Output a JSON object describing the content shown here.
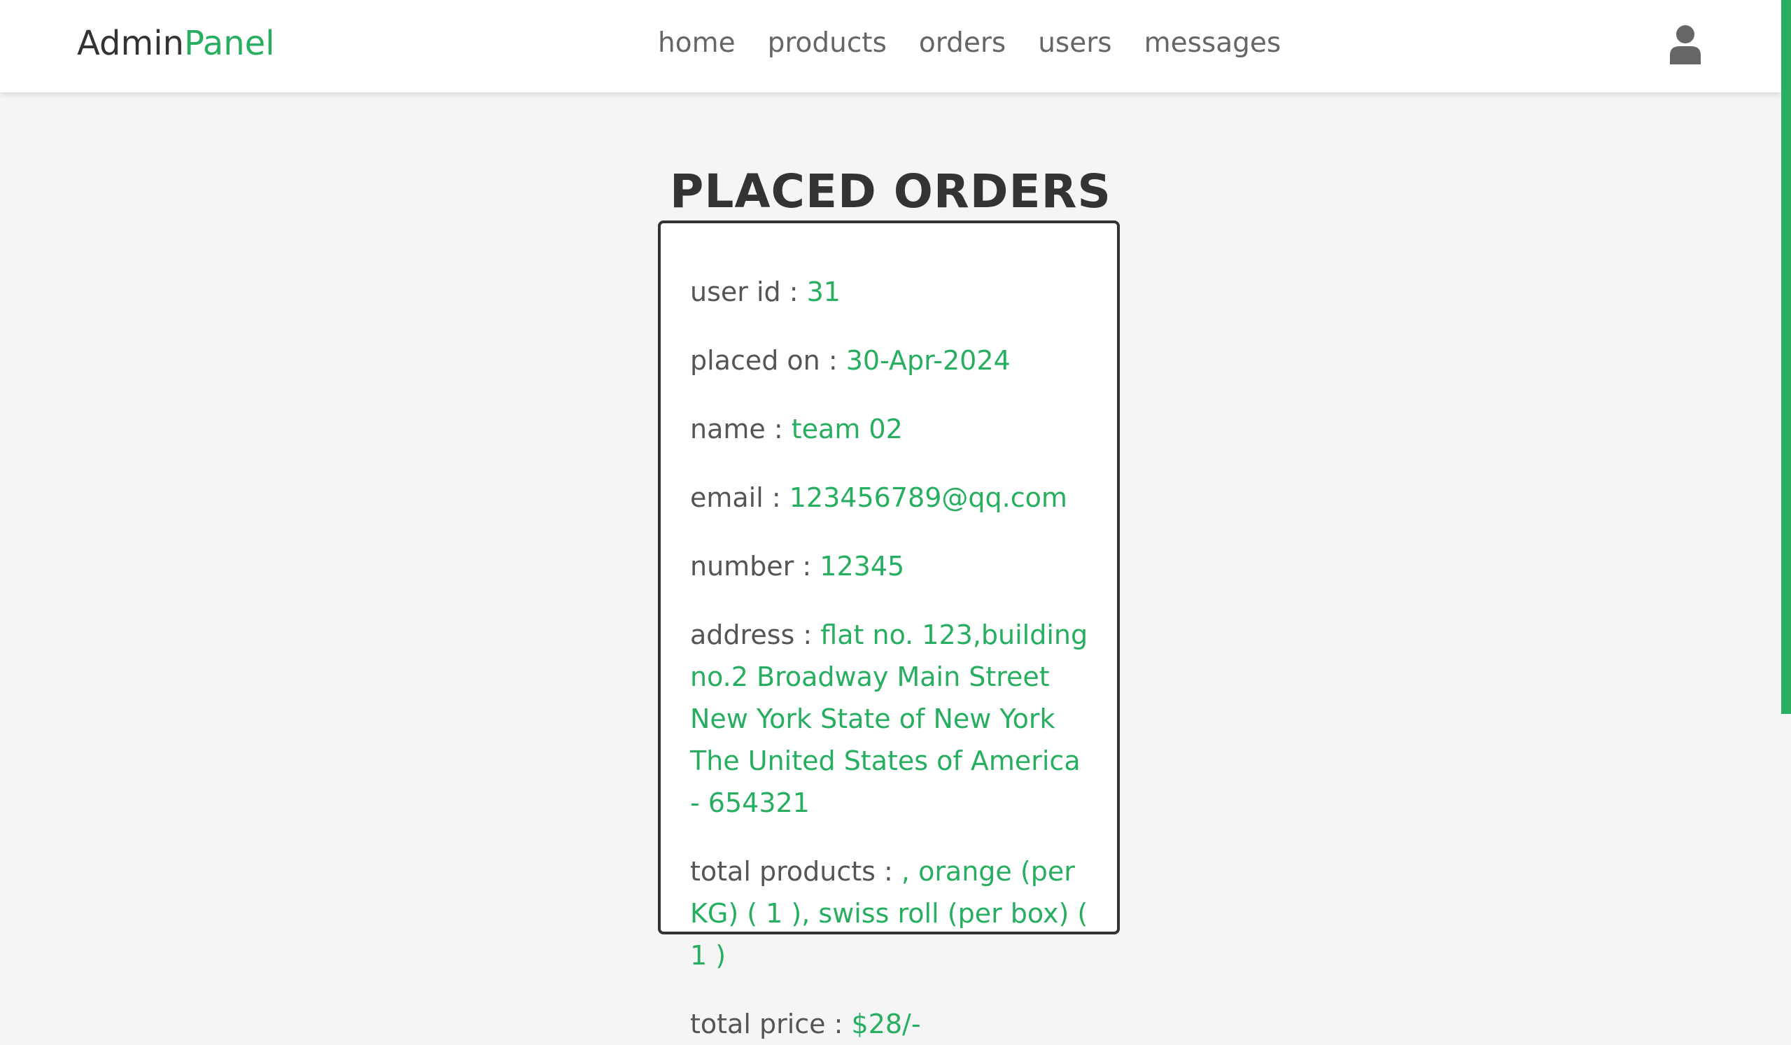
{
  "header": {
    "logo_main": "Admin",
    "logo_accent": "Panel",
    "nav": [
      {
        "label": "home"
      },
      {
        "label": "products"
      },
      {
        "label": "orders"
      },
      {
        "label": "users"
      },
      {
        "label": "messages"
      }
    ],
    "user_icon": "user-icon"
  },
  "page": {
    "title": "PLACED ORDERS"
  },
  "order": {
    "user_id": {
      "label": "user id :",
      "value": "31"
    },
    "placed_on": {
      "label": "placed on :",
      "value": "30-Apr-2024"
    },
    "name": {
      "label": "name :",
      "value": "team 02"
    },
    "email": {
      "label": "email :",
      "value": "123456789@qq.com"
    },
    "number": {
      "label": "number :",
      "value": "12345"
    },
    "address": {
      "label": "address :",
      "value": "flat no. 123,building no.2 Broadway Main Street New York State of New York The United States of America - 654321"
    },
    "total_products": {
      "label": "total products :",
      "value": ", orange (per KG) ( 1 ), swiss roll (per box) ( 1 )"
    },
    "total_price": {
      "label": "total price :",
      "value": "$28/-"
    }
  },
  "colors": {
    "accent": "#27ae60",
    "text_dark": "#333333",
    "text_muted": "#555555",
    "background": "#f5f5f5"
  }
}
